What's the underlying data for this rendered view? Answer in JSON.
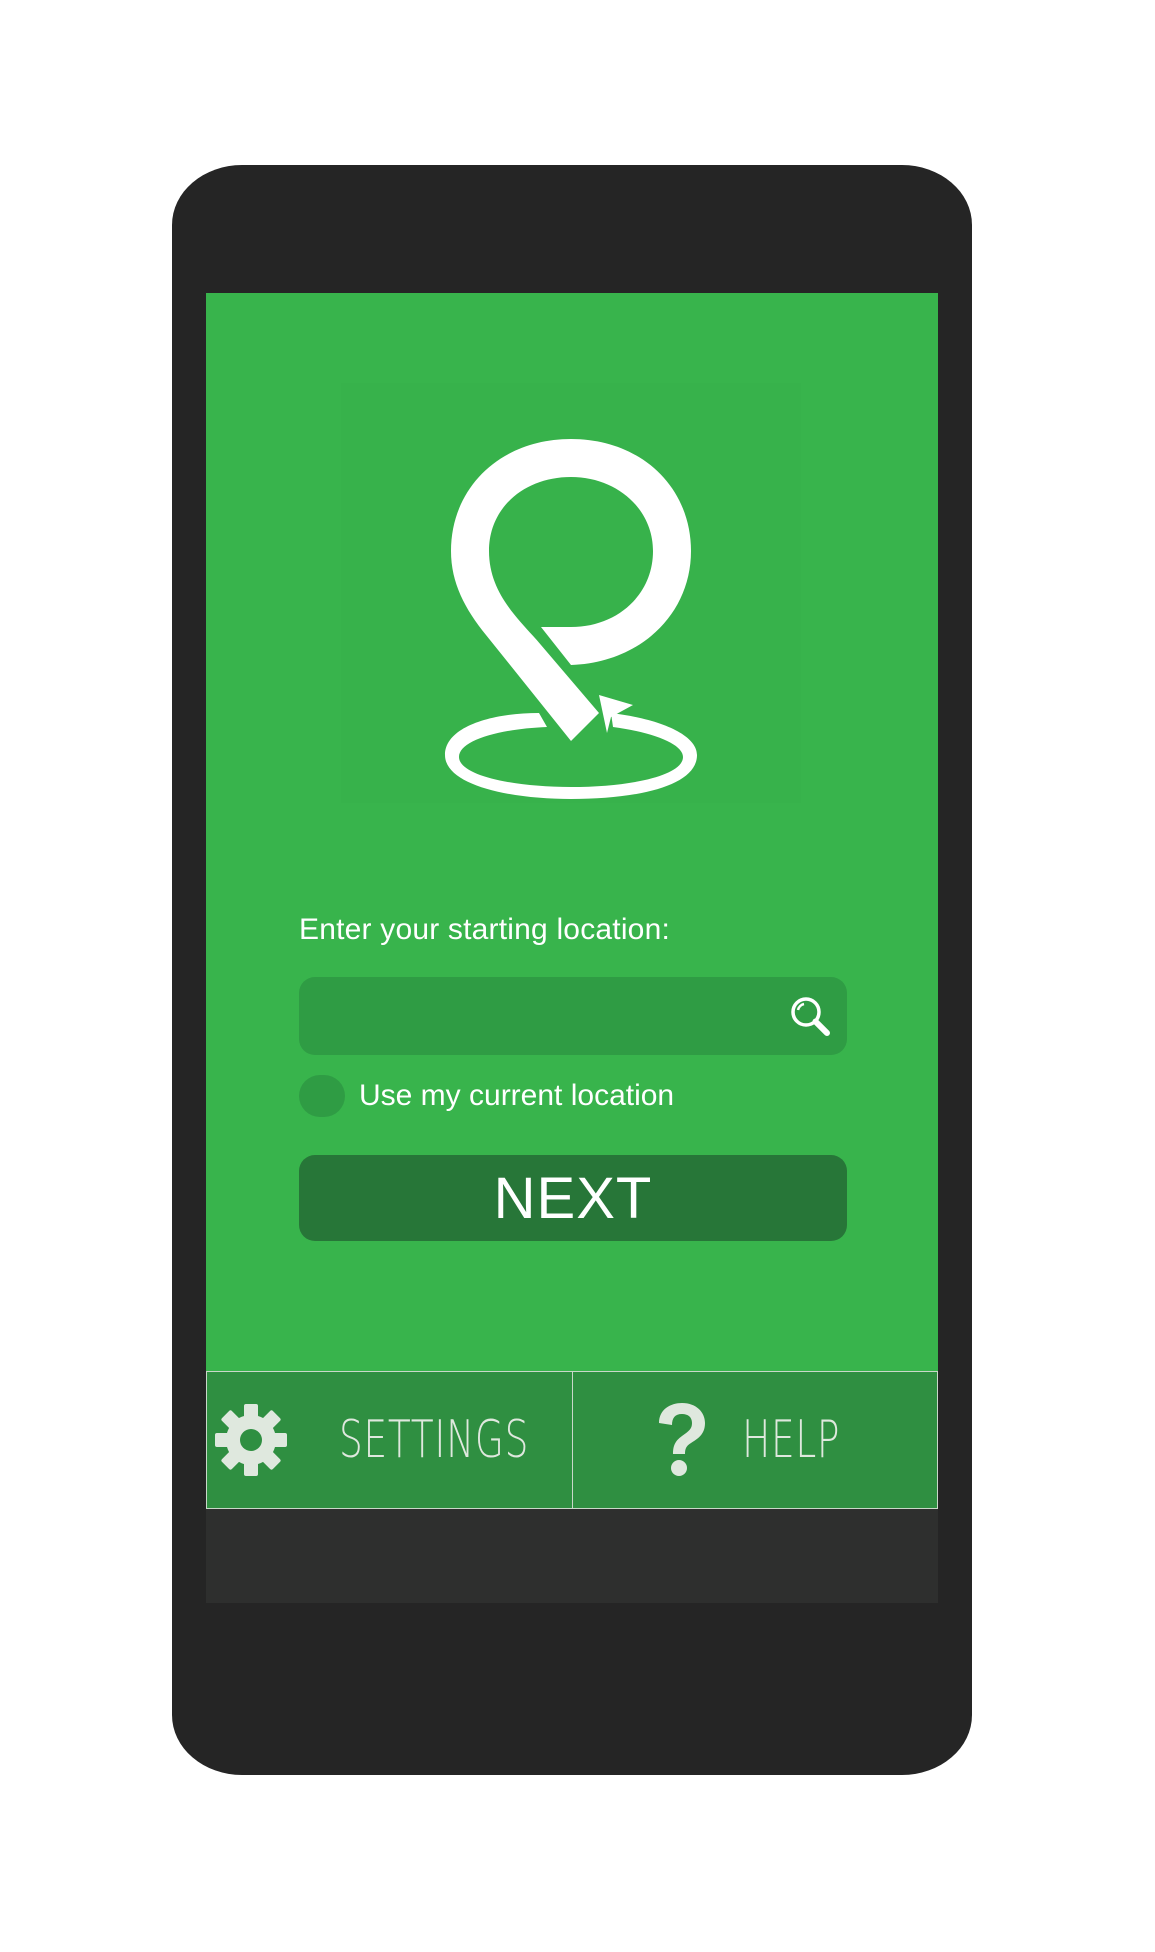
{
  "app": {
    "logo_icon": "location-pin-return-icon"
  },
  "start_form": {
    "prompt": "Enter your starting location:",
    "search_value": "",
    "search_placeholder": "",
    "search_icon": "search-icon",
    "current_location_label": "Use my current location",
    "current_location_checked": false
  },
  "actions": {
    "next_label": "NEXT"
  },
  "bottom_nav": {
    "settings_label": "SETTINGS",
    "settings_icon": "gear-icon",
    "help_label": "HELP",
    "help_icon": "question-mark-icon"
  },
  "colors": {
    "screen": "#38b44c",
    "field": "#2f9c44",
    "button": "#277638",
    "nav": "#2f8f41",
    "phone_body": "#252525"
  }
}
